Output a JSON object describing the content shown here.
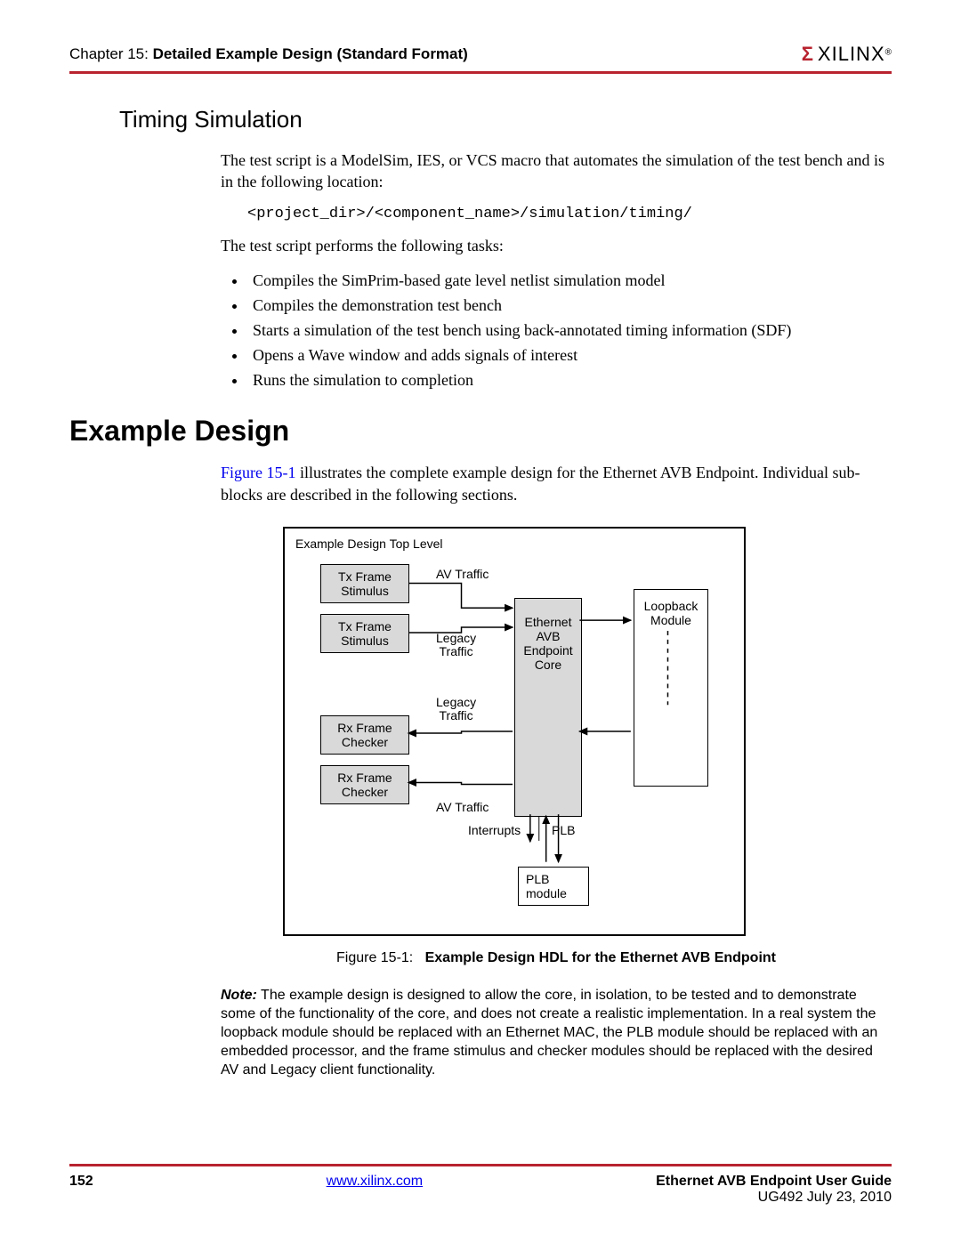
{
  "header": {
    "chapter_prefix": "Chapter 15:",
    "chapter_title": "Detailed Example Design (Standard Format)",
    "logo_mark": "Σ",
    "logo_text": "XILINX",
    "logo_reg": "®"
  },
  "section": {
    "subheading": "Timing Simulation",
    "intro": "The test script is a ModelSim, IES, or VCS macro that automates the simulation of the test bench and is in the following location:",
    "code_path": "<project_dir>/<component_name>/simulation/timing/",
    "tasks_intro": "The test script performs the following tasks:",
    "tasks": [
      "Compiles the SimPrim-based gate level netlist simulation model",
      "Compiles the demonstration test bench",
      "Starts a simulation of the test bench using back-annotated timing information (SDF)",
      "Opens a Wave window and adds signals of interest",
      "Runs the simulation to completion"
    ]
  },
  "example": {
    "heading": "Example Design",
    "fig_ref": "Figure 15-1",
    "body_after_ref": " illustrates the complete example design for the Ethernet AVB Endpoint. Individual sub-blocks are described in the following sections.",
    "caption_prefix": "Figure 15-1:",
    "caption_bold": "Example Design HDL for the Ethernet AVB Endpoint",
    "note_label": "Note:",
    "note_body": "The example design is designed to allow the core, in isolation, to be tested and to demonstrate some of the functionality of the core, and does not create a realistic implementation. In a real system the loopback module should be replaced with an Ethernet MAC, the PLB module should be replaced with an embedded processor, and the frame stimulus and checker modules should be replaced with the desired AV and Legacy client functionality."
  },
  "diagram": {
    "top_label": "Example Design Top Level",
    "tx1": "Tx Frame\nStimulus",
    "tx2": "Tx Frame\nStimulus",
    "rx1": "Rx Frame\nChecker",
    "rx2": "Rx Frame\nChecker",
    "core": "Ethernet\nAVB\nEndpoint\nCore",
    "loopback": "Loopback\nModule",
    "plb": "PLB\nmodule",
    "av_traffic": "AV Traffic",
    "legacy_traffic": "Legacy\nTraffic",
    "interrupts": "Interrupts",
    "plb_label": "PLB"
  },
  "footer": {
    "page": "152",
    "url": "www.xilinx.com",
    "guide": "Ethernet AVB Endpoint User Guide",
    "docid": "UG492 July 23, 2010"
  }
}
